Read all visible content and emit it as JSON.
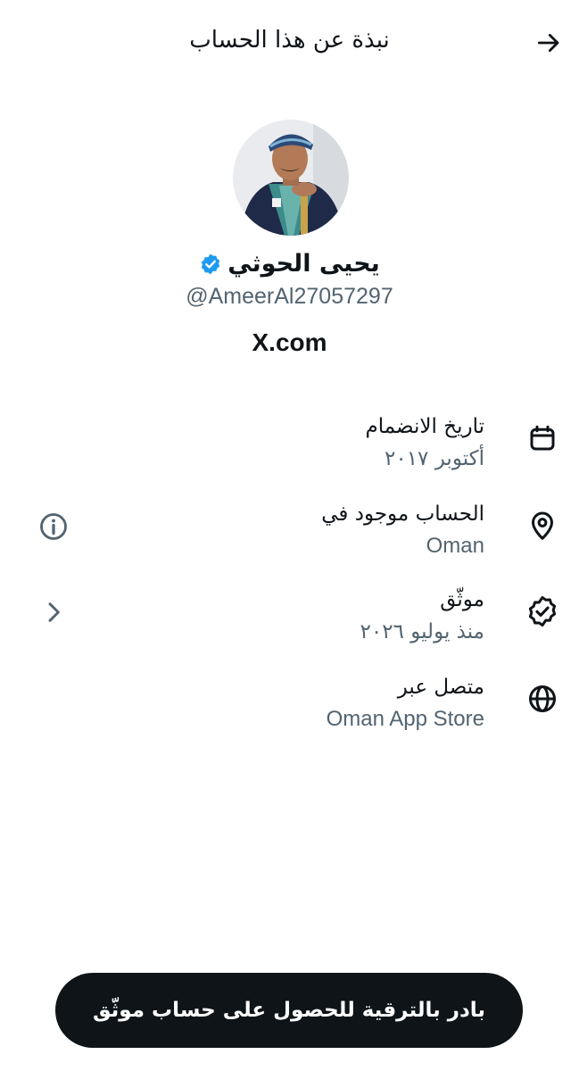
{
  "header": {
    "title": "نبذة عن هذا الحساب",
    "back_icon": "arrow-right-icon"
  },
  "profile": {
    "name": "يحيى الحوثي",
    "handle": "@AmeerAl27057297",
    "verified_color": "#1d9bf0",
    "site": "X.com"
  },
  "details": [
    {
      "label": "تاريخ الانضمام",
      "value": "أكتوبر ٢٠١٧",
      "icon": "calendar-icon"
    },
    {
      "label": "الحساب موجود في",
      "value": "Oman",
      "icon": "location-pin-icon",
      "action_icon": "info-icon"
    },
    {
      "label": "موثّق",
      "value": "منذ يوليو ٢٠٢٦",
      "icon": "verified-badge-icon",
      "action_icon": "chevron-right-icon"
    },
    {
      "label": "متصل عبر",
      "value": "Oman App Store",
      "icon": "globe-icon"
    }
  ],
  "cta": {
    "label": "بادر بالترقية للحصول على حساب موثّق"
  },
  "colors": {
    "text_primary": "#0f1419",
    "text_secondary": "#536471",
    "button_bg": "#0f1419",
    "accent": "#1d9bf0"
  }
}
